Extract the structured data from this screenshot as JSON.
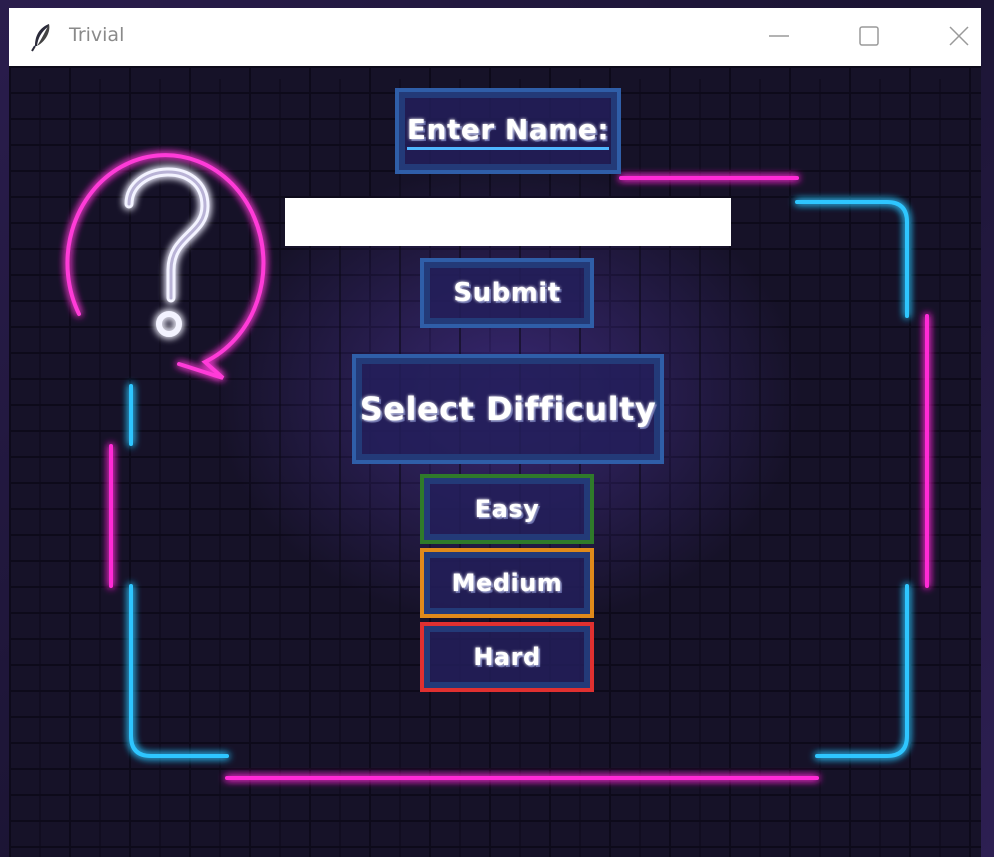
{
  "window": {
    "title": "Trivial",
    "app_icon": "feather-icon",
    "controls": {
      "minimize_icon": "minimize-icon",
      "maximize_icon": "maximize-icon",
      "close_icon": "close-icon"
    }
  },
  "form": {
    "name_label": "Enter Name:",
    "name_value": "",
    "submit_label": "Submit",
    "difficulty_label": "Select Difficulty",
    "difficulties": [
      "Easy",
      "Medium",
      "Hard"
    ]
  },
  "decor": {
    "question_mark_icon": "question-bubble-icon",
    "frame_color_cyan": "#2fc6ff",
    "frame_color_magenta": "#ff2bd6",
    "easy_color": "#2f7a2a",
    "medium_color": "#e08a1a",
    "hard_color": "#e03030"
  }
}
